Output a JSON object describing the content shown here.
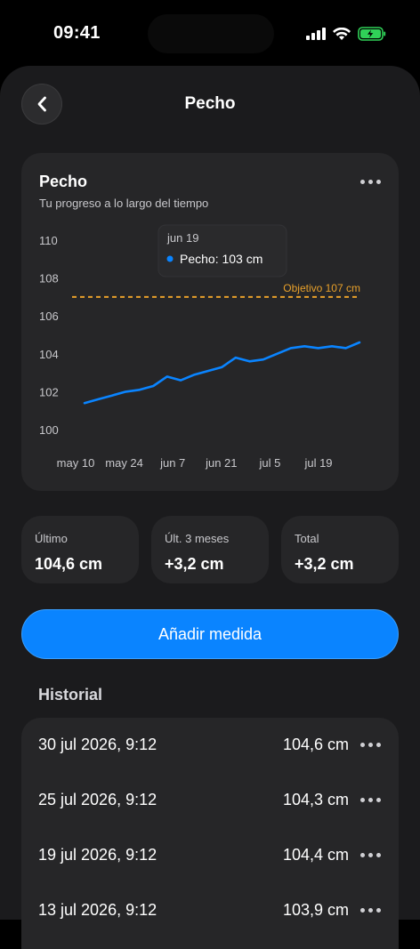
{
  "status_bar": {
    "time": "09:41"
  },
  "header": {
    "title": "Pecho"
  },
  "chart_card": {
    "title": "Pecho",
    "subtitle": "Tu progreso a lo largo del tiempo",
    "tooltip": {
      "date": "jun 19",
      "series": "Pecho:",
      "value": "103 cm"
    },
    "goal_label": "Objetivo 107 cm"
  },
  "chart_data": {
    "type": "line",
    "y_ticks": [
      "110",
      "108",
      "106",
      "104",
      "102",
      "100"
    ],
    "x_ticks": [
      "may 10",
      "may 24",
      "jun 7",
      "jun 21",
      "jul 5",
      "jul 19"
    ],
    "ylim": [
      100,
      110
    ],
    "goal": 107,
    "series": [
      {
        "name": "Pecho",
        "color": "#0a84ff",
        "x": [
          "may 10",
          "may 14",
          "may 18",
          "may 22",
          "may 26",
          "may 30",
          "jun 3",
          "jun 7",
          "jun 11",
          "jun 15",
          "jun 19",
          "jun 23",
          "jun 27",
          "jul 1",
          "jul 5",
          "jul 9",
          "jul 13",
          "jul 17",
          "jul 21",
          "jul 25",
          "jul 30"
        ],
        "values": [
          101.4,
          101.6,
          101.8,
          102.0,
          102.1,
          102.3,
          102.8,
          102.6,
          102.9,
          103.1,
          103.3,
          103.8,
          103.6,
          103.7,
          104.0,
          104.3,
          104.4,
          104.3,
          104.4,
          104.3,
          104.6
        ]
      }
    ],
    "goal_color": "#e8a02a"
  },
  "stats": [
    {
      "label": "Último",
      "value": "104,6 cm"
    },
    {
      "label": "Últ. 3 meses",
      "value": "+3,2 cm"
    },
    {
      "label": "Total",
      "value": "+3,2 cm"
    }
  ],
  "add_button": "Añadir medida",
  "history": {
    "title": "Historial",
    "rows": [
      {
        "date": "30 jul 2026, 9:12",
        "value": "104,6 cm"
      },
      {
        "date": "25 jul 2026, 9:12",
        "value": "104,3 cm"
      },
      {
        "date": "19 jul 2026, 9:12",
        "value": "104,4 cm"
      },
      {
        "date": "13 jul 2026, 9:12",
        "value": "103,9 cm"
      }
    ]
  }
}
